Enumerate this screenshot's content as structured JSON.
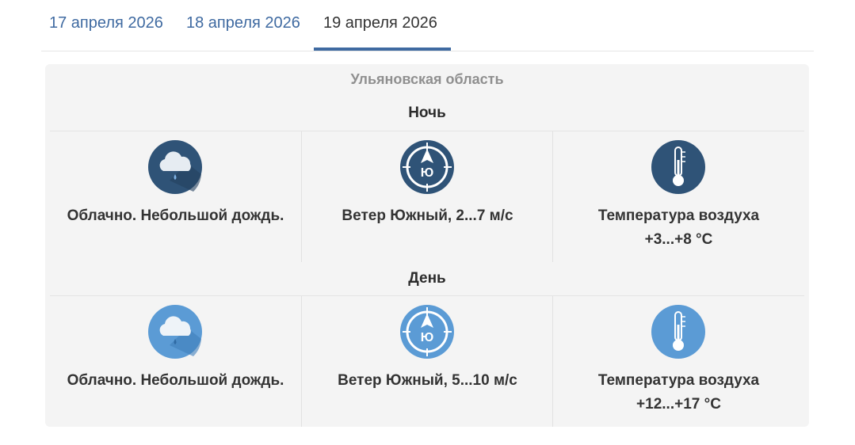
{
  "tabs": [
    {
      "label": "17 апреля 2026",
      "active": false
    },
    {
      "label": "18 апреля 2026",
      "active": false
    },
    {
      "label": "19 апреля 2026",
      "active": true
    }
  ],
  "region": "Ульяновская область",
  "colors": {
    "accent": "#3f6aa1",
    "night_icon": "#2f5377",
    "day_icon": "#5b9bd5"
  },
  "periods": [
    {
      "title": "Ночь",
      "weather": {
        "icon": "cloud-rain-icon",
        "text": "Облачно. Небольшой дождь."
      },
      "wind": {
        "icon": "compass-south-icon",
        "direction_letter": "Ю",
        "text": "Ветер Южный, 2...7 м/с"
      },
      "temperature": {
        "icon": "thermometer-icon",
        "label": "Температура воздуха",
        "value": "+3...+8 °C"
      }
    },
    {
      "title": "День",
      "weather": {
        "icon": "cloud-rain-icon",
        "text": "Облачно. Небольшой дождь."
      },
      "wind": {
        "icon": "compass-south-icon",
        "direction_letter": "Ю",
        "text": "Ветер Южный, 5...10 м/с"
      },
      "temperature": {
        "icon": "thermometer-icon",
        "label": "Температура воздуха",
        "value": "+12...+17 °C"
      }
    }
  ]
}
